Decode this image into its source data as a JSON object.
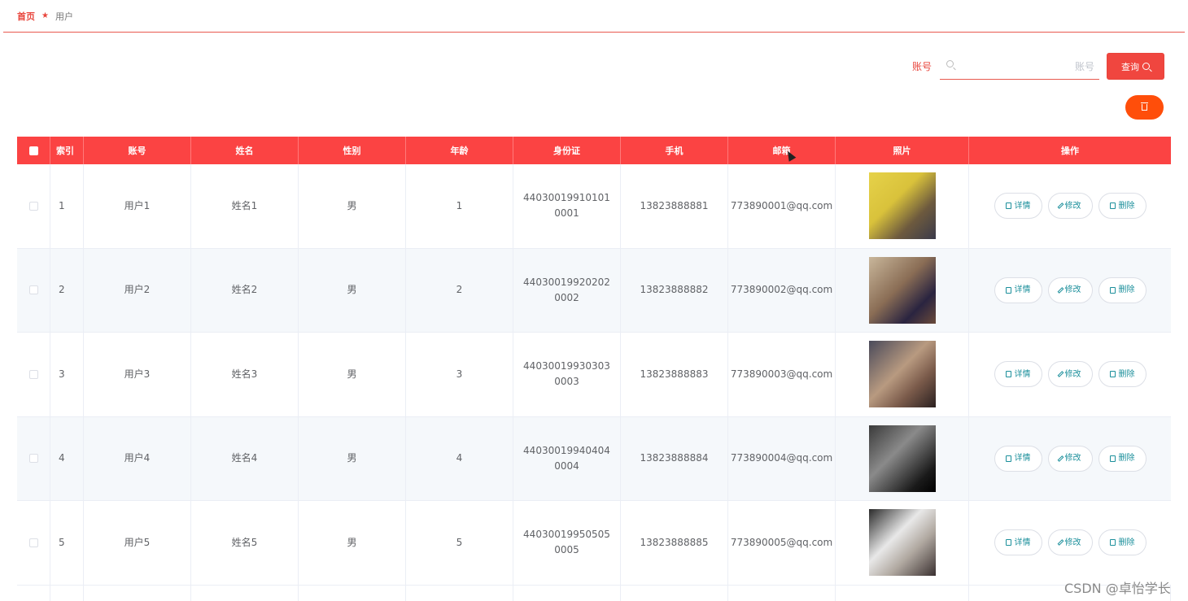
{
  "breadcrumb": {
    "home": "首页",
    "current": "用户"
  },
  "search": {
    "label": "账号",
    "placeholder": "账号",
    "value": "",
    "button_label": "查询"
  },
  "colors": {
    "accent": "#fb4343",
    "delete_all": "#ff4e0a",
    "op_text": "#1b8f9b"
  },
  "table": {
    "headers": [
      "索引",
      "账号",
      "姓名",
      "性别",
      "年龄",
      "身份证",
      "手机",
      "邮箱",
      "照片",
      "操作"
    ],
    "actions": {
      "detail": "详情",
      "edit": "修改",
      "delete": "删除"
    },
    "rows": [
      {
        "index": "1",
        "account": "用户1",
        "name": "姓名1",
        "sex": "男",
        "age": "1",
        "id_card": "440300199101010001",
        "phone": "13823888881",
        "email": "773890001@qq.com"
      },
      {
        "index": "2",
        "account": "用户2",
        "name": "姓名2",
        "sex": "男",
        "age": "2",
        "id_card": "440300199202020002",
        "phone": "13823888882",
        "email": "773890002@qq.com"
      },
      {
        "index": "3",
        "account": "用户3",
        "name": "姓名3",
        "sex": "男",
        "age": "3",
        "id_card": "440300199303030003",
        "phone": "13823888883",
        "email": "773890003@qq.com"
      },
      {
        "index": "4",
        "account": "用户4",
        "name": "姓名4",
        "sex": "男",
        "age": "4",
        "id_card": "440300199404040004",
        "phone": "13823888884",
        "email": "773890004@qq.com"
      },
      {
        "index": "5",
        "account": "用户5",
        "name": "姓名5",
        "sex": "男",
        "age": "5",
        "id_card": "440300199505050005",
        "phone": "13823888885",
        "email": "773890005@qq.com"
      }
    ]
  },
  "watermark": "CSDN @卓怡学长"
}
